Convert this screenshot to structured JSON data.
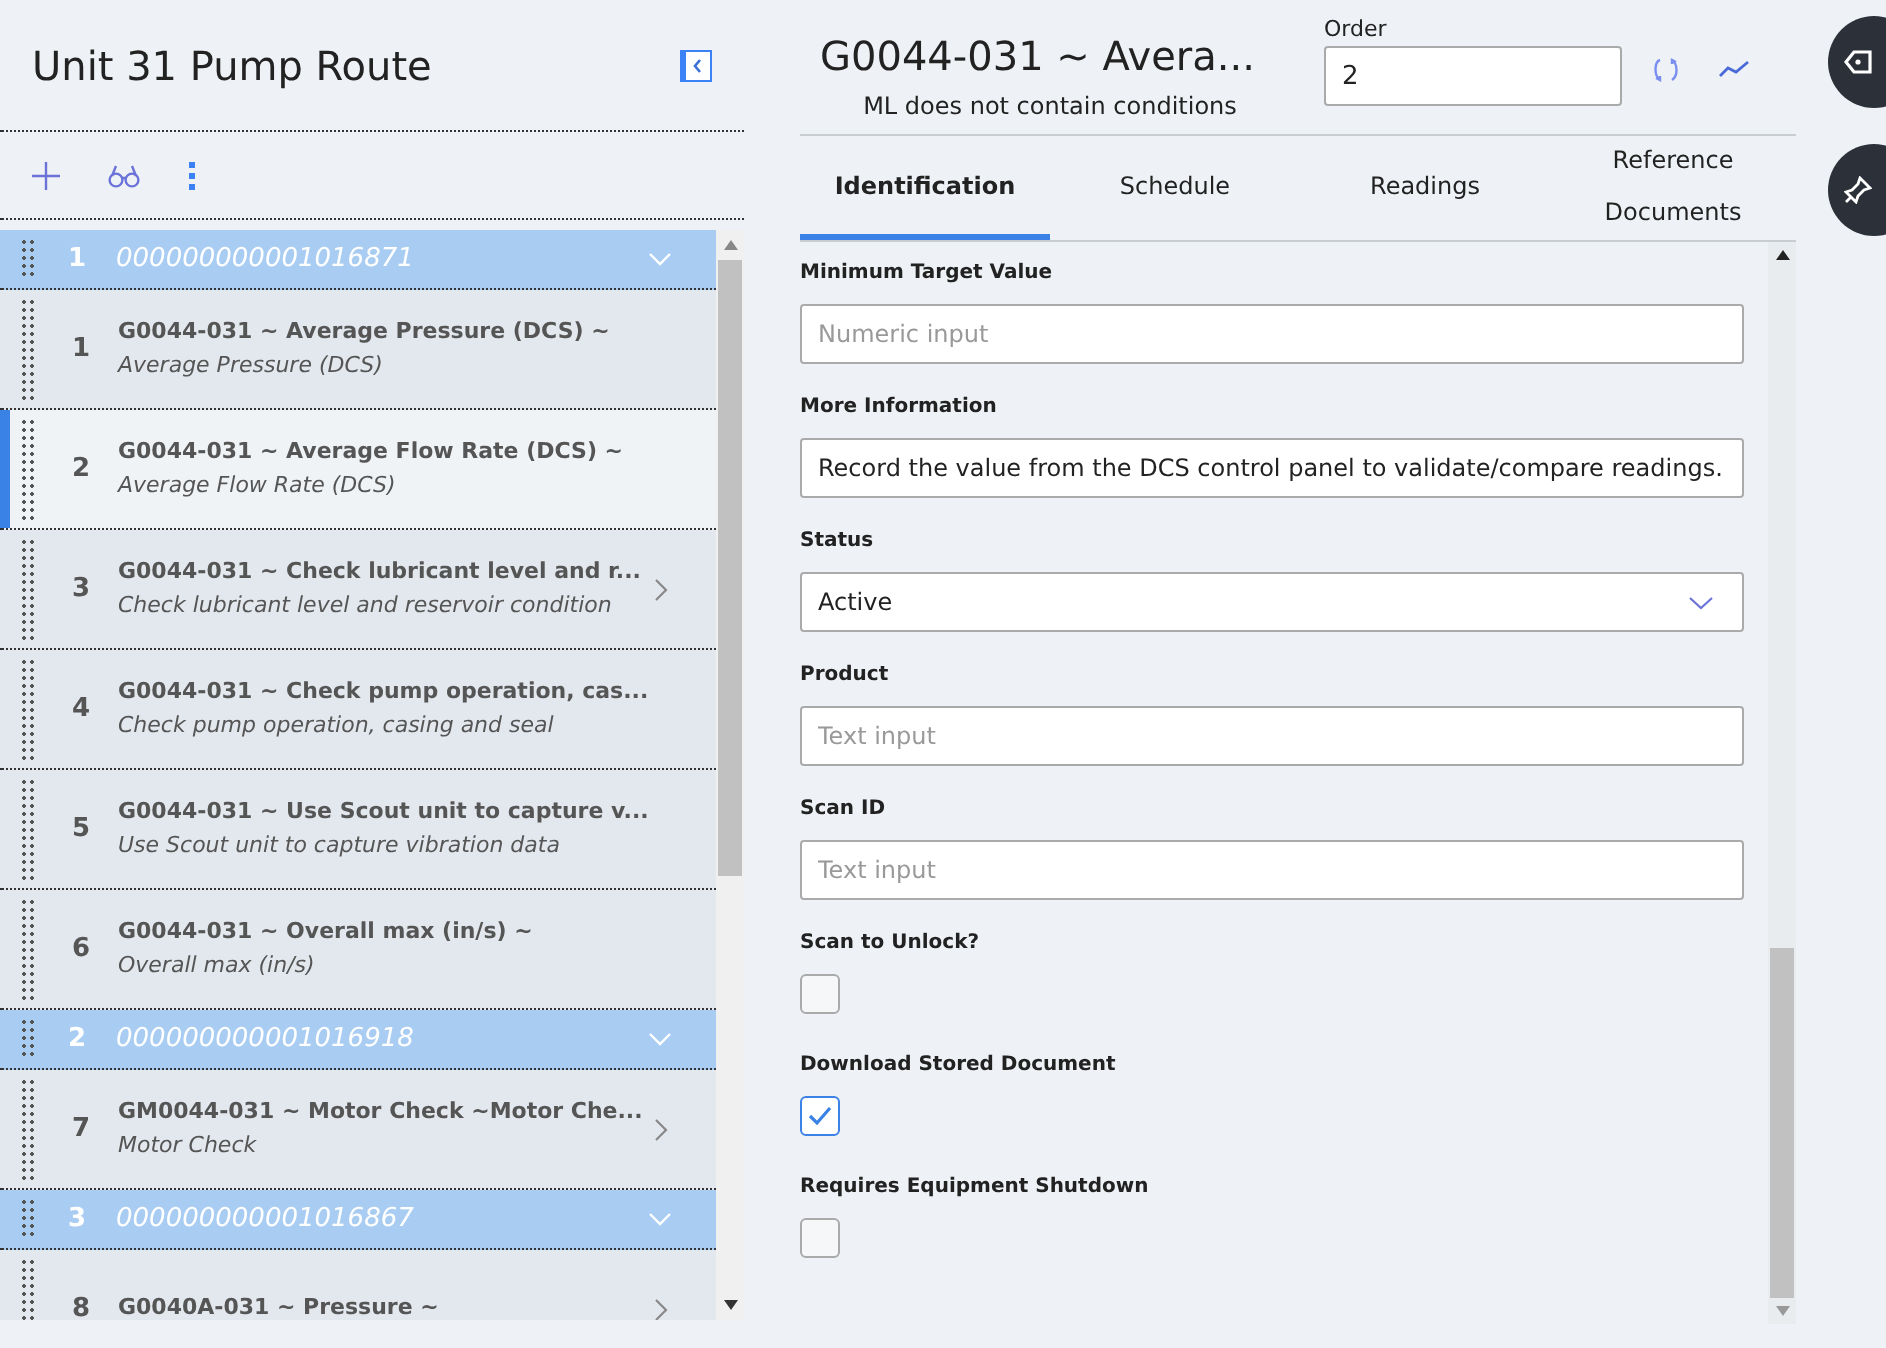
{
  "route": {
    "title": "Unit 31 Pump Route"
  },
  "list": [
    {
      "kind": "group",
      "number": "1",
      "label": "000000000001016871",
      "expanded": true
    },
    {
      "kind": "item",
      "number": "1",
      "title": "G0044-031 ~ Average Pressure (DCS) ~",
      "subtitle": "Average Pressure (DCS)",
      "selected": false,
      "has_chevron": false
    },
    {
      "kind": "item",
      "number": "2",
      "title": "G0044-031 ~ Average Flow Rate (DCS) ~",
      "subtitle": "Average Flow Rate (DCS)",
      "selected": true,
      "has_chevron": false
    },
    {
      "kind": "item",
      "number": "3",
      "title": "G0044-031 ~ Check lubricant level and r...",
      "subtitle": "Check lubricant level and reservoir condition",
      "selected": false,
      "has_chevron": true
    },
    {
      "kind": "item",
      "number": "4",
      "title": "G0044-031 ~ Check pump operation, cas...",
      "subtitle": "Check pump operation, casing and seal",
      "selected": false,
      "has_chevron": false
    },
    {
      "kind": "item",
      "number": "5",
      "title": "G0044-031 ~ Use Scout unit to capture v...",
      "subtitle": "Use Scout unit to capture vibration data",
      "selected": false,
      "has_chevron": false
    },
    {
      "kind": "item",
      "number": "6",
      "title": "G0044-031 ~ Overall max (in/s) ~",
      "subtitle": "Overall max (in/s)",
      "selected": false,
      "has_chevron": false
    },
    {
      "kind": "group",
      "number": "2",
      "label": "000000000001016918",
      "expanded": true
    },
    {
      "kind": "item",
      "number": "7",
      "title": "GM0044-031 ~ Motor Check ~Motor Che...",
      "subtitle": "Motor Check",
      "selected": false,
      "has_chevron": true
    },
    {
      "kind": "group",
      "number": "3",
      "label": "000000000001016867",
      "expanded": true
    },
    {
      "kind": "item",
      "number": "8",
      "title": "G0040A-031 ~ Pressure ~",
      "selected": false,
      "has_chevron": true
    }
  ],
  "detail": {
    "title": "G0044-031 ~ Avera...",
    "subtitle": "ML does not contain conditions",
    "order_label": "Order",
    "order_value": "2"
  },
  "tabs": [
    {
      "label": "Identification",
      "selected": true
    },
    {
      "label": "Schedule",
      "selected": false
    },
    {
      "label": "Readings",
      "selected": false
    },
    {
      "label": "Reference Documents",
      "selected": false
    }
  ],
  "fields": [
    {
      "kind": "input",
      "label": "Minimum Target Value",
      "placeholder": "Numeric input"
    },
    {
      "kind": "input",
      "label": "More Information",
      "value": "Record the value from the DCS control panel to validate/compare readings."
    },
    {
      "kind": "select",
      "label": "Status",
      "value": "Active"
    },
    {
      "kind": "input",
      "label": "Product",
      "placeholder": "Text input"
    },
    {
      "kind": "input",
      "label": "Scan ID",
      "placeholder": "Text input"
    },
    {
      "kind": "checkbox",
      "label": "Scan to Unlock?",
      "checked": false
    },
    {
      "kind": "checkbox",
      "label": "Download Stored Document",
      "checked": true
    },
    {
      "kind": "checkbox",
      "label": "Requires Equipment Shutdown",
      "checked": false
    }
  ]
}
